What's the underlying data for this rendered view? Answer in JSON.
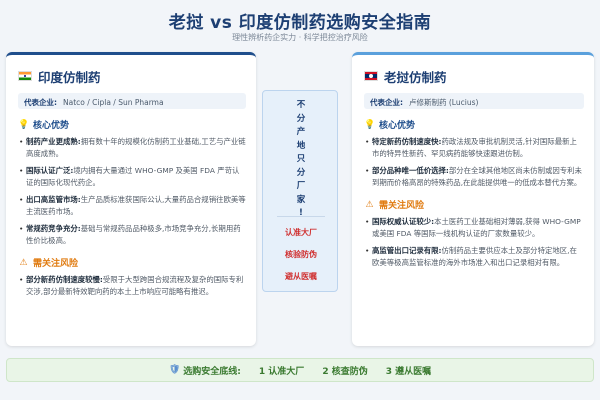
{
  "title": "老挝 vs 印度仿制药选购安全指南",
  "subtitle": "理性辨析药企实力 · 科学把控治疗风险",
  "left": {
    "flag": "india-flag",
    "name": "印度仿制药",
    "rep_label": "代表企业:",
    "rep_value": "Natco / Cipla / Sun Pharma",
    "adv_title": "核心优势",
    "advantages": [
      {
        "bold": "制药产业更成熟:",
        "text": "拥有数十年的规模化仿制药工业基础,工艺与产业链高度成熟。"
      },
      {
        "bold": "国际认证广泛:",
        "text": "境内拥有大量通过 WHO-GMP 及美国 FDA 严苛认证的国际化现代药企。"
      },
      {
        "bold": "出口高监管市场:",
        "text": "生产品质标准获国际公认,大量药品合规销往欧美等主流医药市场。"
      },
      {
        "bold": "常规药竞争充分:",
        "text": "基础与常规药品品种极多,市场竞争充分,长期用药性价比极高。"
      }
    ],
    "risk_title": "需关注风险",
    "risks": [
      {
        "bold": "部分新药仿制速度较慢:",
        "text": "受限于大型跨国合规流程及复杂的国际专利交涉,部分最新特效靶向药的本土上市响应可能略有推迟。"
      }
    ]
  },
  "center": {
    "slogan": [
      "不",
      "分",
      "产",
      "地",
      "只",
      "分",
      "厂",
      "家",
      "!"
    ],
    "points": [
      "认准大厂",
      "核验防伪",
      "避从医嘱"
    ]
  },
  "right": {
    "flag": "laos-flag",
    "name": "老挝仿制药",
    "rep_label": "代表企业:",
    "rep_value": "卢修斯制药 (Lucius)",
    "adv_title": "核心优势",
    "advantages": [
      {
        "bold": "特定新药仿制速度快:",
        "text": "药政法规及审批机制灵活,针对国际最新上市的特异性新药、罕见病药能够快速跟进仿制。"
      },
      {
        "bold": "部分品种唯一低价选择:",
        "text": "部分在全球其他地区尚未仿制或因专利未到期而价格高昂的特殊药品,在此能提供唯一的低成本替代方案。"
      }
    ],
    "risk_title": "需关注风险",
    "risks": [
      {
        "bold": "国际权威认证较少:",
        "text": "本土医药工业基础相对薄弱,获得 WHO-GMP 或美国 FDA 等国际一线机构认证的厂家数量较少。"
      },
      {
        "bold": "高监管出口记录有限:",
        "text": "仿制药品主要供应本土及部分特定地区,在欧美等极高监管标准的海外市场准入和出口记录相对有限。"
      }
    ]
  },
  "bottom": {
    "label": "选购安全底线:",
    "points": [
      "1 认准大厂",
      "2 核查防伪",
      "3 遵从医嘱"
    ]
  }
}
